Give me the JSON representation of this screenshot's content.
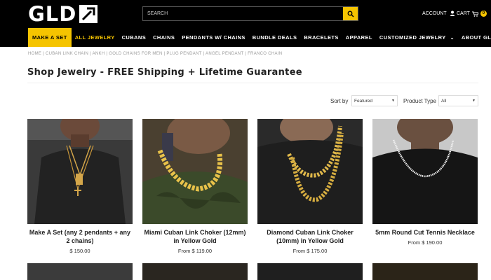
{
  "header": {
    "logo_text": "GLD",
    "search": {
      "placeholder": "SEARCH"
    },
    "account_label": "ACCOUNT",
    "cart_label": "CART",
    "cart_count": "0"
  },
  "nav": {
    "items": [
      {
        "label": "MAKE A SET"
      },
      {
        "label": "ALL JEWELRY"
      },
      {
        "label": "CUBANS"
      },
      {
        "label": "CHAINS"
      },
      {
        "label": "PENDANTS W/ CHAINS"
      },
      {
        "label": "BUNDLE DEALS"
      },
      {
        "label": "BRACELETS"
      },
      {
        "label": "APPAREL"
      },
      {
        "label": "CUSTOMIZED JEWELRY"
      },
      {
        "label": "ABOUT GLD"
      }
    ]
  },
  "breadcrumb": "HOME | CUBAN LINK CHAIN | ANKH | GOLD CHAINS FOR MEN | PLUG PENDANT | ANGEL PENDANT | FRANCO CHAIN",
  "page_title": "Shop Jewelry - FREE Shipping + Lifetime Guarantee",
  "filters": {
    "sort_label": "Sort by",
    "sort_value": "Featured",
    "type_label": "Product Type",
    "type_value": "All"
  },
  "products": [
    {
      "title": "Make A Set (any 2 pendants + any 2 chains)",
      "price": "$ 150.00"
    },
    {
      "title": "Miami Cuban Link Choker (12mm) in Yellow Gold",
      "price": "From $ 119.00"
    },
    {
      "title": "Diamond Cuban Link Choker (10mm) in Yellow Gold",
      "price": "From $ 175.00"
    },
    {
      "title": "5mm Round Cut Tennis Necklace",
      "price": "From $ 190.00"
    }
  ],
  "colors": {
    "accent": "#f5c400",
    "header_bg": "#000000"
  }
}
